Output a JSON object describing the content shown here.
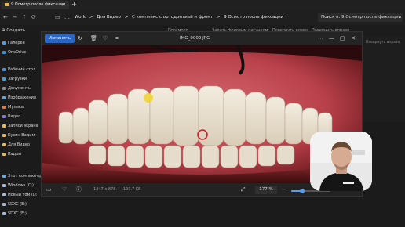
{
  "explorer": {
    "tab_title": "9 Осмотр после фиксации",
    "tab_close": "✕",
    "tab_add": "+",
    "nav": {
      "back": "←",
      "forward": "→",
      "up": "↑",
      "refresh": "⟳",
      "monitor": "▭",
      "more": "…"
    },
    "address_parts": [
      "Work",
      ">",
      "Для Видео",
      ">",
      "С комплекс с ортодонтией и фронт",
      ">",
      "9 Осмотр после фиксации"
    ],
    "search_placeholder": "Поиск в: 9 Осмотр после фиксации",
    "create_label": "⊕ Создать",
    "toolbar_items": [
      "Просмотр",
      "Задать фоновым рисунком",
      "Повернуть влево",
      "Повернуть вправо"
    ]
  },
  "sidebar": {
    "items": [
      {
        "label": "Галерея",
        "color": "#4aa0e6"
      },
      {
        "label": "OneDrive",
        "color": "#3b8ee0"
      },
      {
        "label": "Рабочий стол",
        "color": "#4a8fd8"
      },
      {
        "label": "Загрузки",
        "color": "#3aa0d8"
      },
      {
        "label": "Документы",
        "color": "#8a8a8a"
      },
      {
        "label": "Изображения",
        "color": "#58a6e8"
      },
      {
        "label": "Музыка",
        "color": "#e07a44"
      },
      {
        "label": "Видео",
        "color": "#8f6fd8"
      },
      {
        "label": "Записи экрана",
        "color": "#e8b54a"
      },
      {
        "label": "Кузин Вадим",
        "color": "#e8b54a"
      },
      {
        "label": "Для Видео",
        "color": "#e8b54a"
      },
      {
        "label": "Кадры",
        "color": "#e8b54a"
      },
      {
        "label": "Этот компьютер",
        "color": "#6aa8e8"
      },
      {
        "label": "Windows (C:)",
        "color": "#9fb8d8"
      },
      {
        "label": "Новый том (D:)",
        "color": "#9fb8d8"
      },
      {
        "label": "SDXC (E:)",
        "color": "#9fb8d8"
      },
      {
        "label": "SDXC (E:)",
        "color": "#9fb8d8"
      }
    ]
  },
  "viewer": {
    "edit_label": "Изменить",
    "filename": "IMG_0002.JPG",
    "dims": "1347 x 878",
    "filesize": "193.7 KB",
    "zoom": "177 %",
    "zoom_fraction": 0.28,
    "icons": [
      "rotate-icon",
      "delete-icon",
      "favorite-icon",
      "crop-icon"
    ],
    "controls": {
      "min": "—",
      "max": "▢",
      "close": "✕",
      "more": "⋯"
    },
    "accent": "#2a67c5"
  },
  "right_strip": {
    "items": [
      "Повернуть вправо"
    ]
  }
}
